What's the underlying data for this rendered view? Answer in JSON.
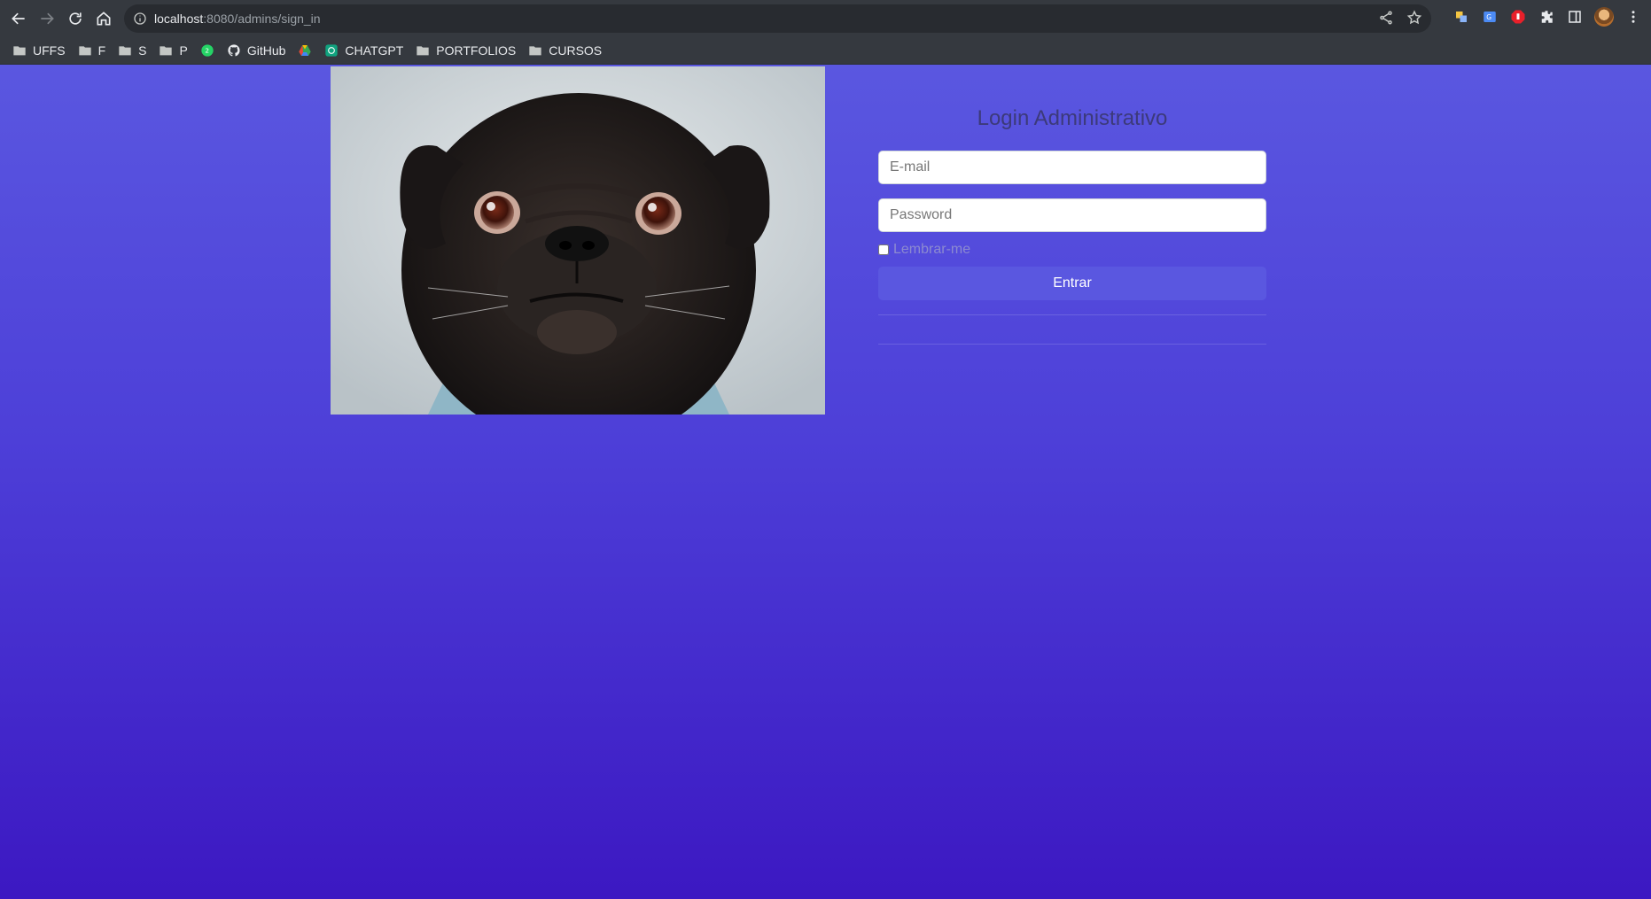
{
  "browser": {
    "url_host": "localhost",
    "url_path": ":8080/admins/sign_in",
    "bookmarks": [
      {
        "label": "UFFS",
        "icon": "folder-icon"
      },
      {
        "label": "F",
        "icon": "folder-icon"
      },
      {
        "label": "S",
        "icon": "folder-icon"
      },
      {
        "label": "P",
        "icon": "folder-icon"
      },
      {
        "label": "",
        "icon": "whatsapp-icon",
        "badge": "2"
      },
      {
        "label": "GitHub",
        "icon": "github-icon"
      },
      {
        "label": "",
        "icon": "drive-icon"
      },
      {
        "label": "CHATGPT",
        "icon": "chatgpt-icon"
      },
      {
        "label": "PORTFOLIOS",
        "icon": "folder-icon"
      },
      {
        "label": "CURSOS",
        "icon": "folder-icon"
      }
    ]
  },
  "login": {
    "title": "Login Administrativo",
    "email_placeholder": "E-mail",
    "password_placeholder": "Password",
    "remember_label": "Lembrar-me",
    "submit_label": "Entrar"
  },
  "colors": {
    "chrome": "#35393f",
    "page_top": "#5a57e0",
    "page_bottom": "#3c18c2",
    "button": "#5a57e0"
  }
}
